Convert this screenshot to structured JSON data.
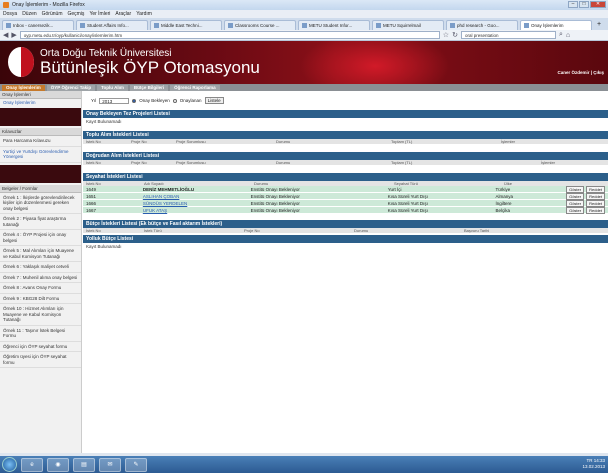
{
  "window": {
    "title": "Onay İşlemlerim - Mozilla Firefox"
  },
  "menu": [
    "Dosya",
    "Düzen",
    "Görünüm",
    "Geçmiş",
    "Yer İmleri",
    "Araçlar",
    "Yardım"
  ],
  "tabs": [
    {
      "label": "Inbox - canersezik...",
      "active": false
    },
    {
      "label": "Student Affairs Info...",
      "active": false
    },
    {
      "label": "Middle East Techni...",
      "active": false
    },
    {
      "label": "Classrooms Course ...",
      "active": false
    },
    {
      "label": "METU Student Infor...",
      "active": false
    },
    {
      "label": "METU Squirrelmail",
      "active": false
    },
    {
      "label": "phd research - Goo...",
      "active": false
    },
    {
      "label": "Onay İşlemlerim",
      "active": true
    }
  ],
  "address": {
    "url": "oyp.metu.edu.tr/oyp/kullanici/onay/islemlerim.htm",
    "search": "oral presentation"
  },
  "banner": {
    "line1": "Orta Doğu Teknik Üniversitesi",
    "line2": "Bütünleşik ÖYP Otomasyonu",
    "user": "Caner Özdemir | Çıkış"
  },
  "topnav": [
    {
      "label": "Onay İşlemlerim",
      "on": true
    },
    {
      "label": "ÖYP Öğrenci Takip",
      "on": false
    },
    {
      "label": "Toplu Alım",
      "on": false
    },
    {
      "label": "Bütçe Bilgileri",
      "on": false
    },
    {
      "label": "Öğrenci Raporlama",
      "on": false
    }
  ],
  "sidebar": {
    "head1": "Onay İşlemleri",
    "link1": "Onay İşlemlerim",
    "head2": "Kılavuzlar",
    "kil1": "Para Harcama Kılavuzu",
    "kil2": "Yurtiçi ve Yurtdışı Görevlendirme Yönergesi",
    "head3": "Belgeler / Formlar",
    "items": [
      "Örnek 1 : İkişlerde görevlendirilecek kişiler için düzenlenmesi gereken onay belgesi",
      "Örnek 2 : Piyasa fiyat araştırma tutanağı",
      "Örnek 4 : ÖYP Projesi için onay belgesi",
      "Örnek 5 : Mal Alımları için Muayene ve Kabul Komisyon Tutanağı",
      "Örnek 6 : Yaklaşık maliyet cetveli",
      "Örnek 7 : Muhenil alıma onay belgesi",
      "Örnek 8 : Avans Onay Formu",
      "Örnek 9 : KBG28 Dilt Formu",
      "Örnek 10 : Hizmet Alımları için Muayene ve Kabul Komisyon Tutanağı",
      "Örnek 11 : Taşınır İstek Belgesi Formu",
      "Öğrenci için ÖYP seyahat formu",
      "Öğretim üyesi için ÖYP seyahat formu"
    ]
  },
  "filter": {
    "year_label": "Yıl",
    "year": "2013",
    "opt1": "Onay Bekleyen",
    "opt2": "Onaylanan",
    "list_btn": "Listele"
  },
  "sections": {
    "tez": {
      "title": "Onay Bekleyen Tez Projeleri Listesi",
      "nores": "Kayıt Bulunamadı"
    },
    "toplu": {
      "title": "Toplu Alım İstekleri Listesi",
      "cols": [
        "İstek No",
        "Proje No",
        "Proje Sorumlusu",
        "Durumu",
        "Toplam (TL)",
        "İşlemler"
      ]
    },
    "dogrudan": {
      "title": "Doğrudan Alım İstekleri Listesi",
      "cols": [
        "İstek No",
        "Proje No",
        "Proje Sorumlusu",
        "Durumu",
        "Toplam (TL)",
        "İşlemler"
      ]
    },
    "seyahat": {
      "title": "Seyahat İstekleri Listesi",
      "cols": [
        "İstek No",
        "Adı Soyadı",
        "Durumu",
        "Seyahat Türü",
        "Ülke"
      ],
      "rows": [
        {
          "no": "1649",
          "name": "DENİZ MEHMETLİOĞLU",
          "durum": "Enstitü Onayı Bekleniyor",
          "tur": "Yurt İçi",
          "ulke": "Türkiye"
        },
        {
          "no": "1651",
          "name": "ASLIHAN ÇOBAN",
          "durum": "Enstitü Onayı Bekleniyor",
          "tur": "Kısa Süreli Yurt Dışı",
          "ulke": "Almanya"
        },
        {
          "no": "1666",
          "name": "SÜNDÜS YERDELEN",
          "durum": "Enstitü Onayı Bekleniyor",
          "tur": "Kısa Süreli Yurt Dışı",
          "ulke": "İngiltere"
        },
        {
          "no": "1667",
          "name": "UFUK ATAŞ",
          "durum": "Enstitü Onayı Bekleniyor",
          "tur": "Kısa Süreli Yurt Dışı",
          "ulke": "Belçika"
        }
      ],
      "btn_show": "Göster",
      "btn_reject": "Reddet"
    },
    "butce": {
      "title": "Bütçe İstekleri Listesi (Ek bütçe ve Fasıl aktarım İstekleri)",
      "cols": [
        "İstek No",
        "İstek Türü",
        "Proje No",
        "Durumu",
        "Başvuru Tarihi"
      ]
    },
    "yolluk": {
      "title": "Yolluk Bütçe Listesi",
      "nores": "Kayıt Bulunamadı"
    }
  },
  "tray": {
    "lang": "TR",
    "time": "14:33",
    "date": "13.02.2013"
  }
}
